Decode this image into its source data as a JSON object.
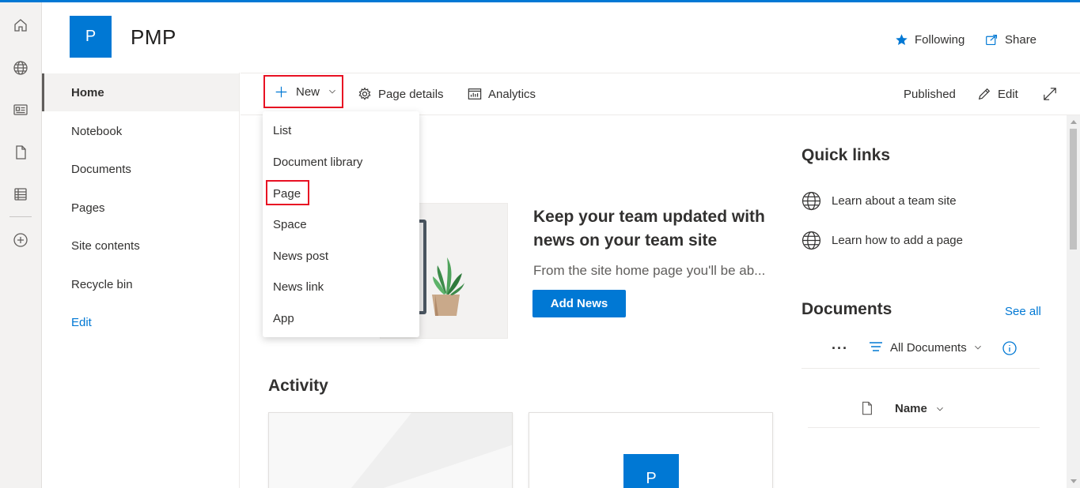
{
  "site": {
    "logo_letter": "P",
    "title": "PMP",
    "following_label": "Following",
    "share_label": "Share"
  },
  "appbar": {
    "icons": [
      "home-icon",
      "globe-icon",
      "news-icon",
      "file-icon",
      "list-icon",
      "plus-circle-icon"
    ]
  },
  "leftnav": {
    "items": [
      {
        "label": "Home"
      },
      {
        "label": "Notebook"
      },
      {
        "label": "Documents"
      },
      {
        "label": "Pages"
      },
      {
        "label": "Site contents"
      },
      {
        "label": "Recycle bin"
      }
    ],
    "edit_label": "Edit"
  },
  "commandbar": {
    "new_label": "New",
    "page_details_label": "Page details",
    "analytics_label": "Analytics",
    "published_label": "Published",
    "edit_label": "Edit"
  },
  "new_menu": {
    "items": [
      {
        "label": "List"
      },
      {
        "label": "Document library"
      },
      {
        "label": "Page"
      },
      {
        "label": "Space"
      },
      {
        "label": "News post"
      },
      {
        "label": "News link"
      },
      {
        "label": "App"
      }
    ]
  },
  "news": {
    "title": "Keep your team updated with news on your team site",
    "description": "From the site home page you'll be ab...",
    "add_news_label": "Add News"
  },
  "activity": {
    "title": "Activity",
    "card_logo_letter": "P"
  },
  "quick_links": {
    "title": "Quick links",
    "items": [
      {
        "label": "Learn about a team site"
      },
      {
        "label": "Learn how to add a page"
      }
    ]
  },
  "documents": {
    "title": "Documents",
    "see_all_label": "See all",
    "view_label": "All Documents",
    "name_column_label": "Name"
  },
  "colors": {
    "accent": "#0078d4",
    "highlight_border": "#e81123"
  }
}
